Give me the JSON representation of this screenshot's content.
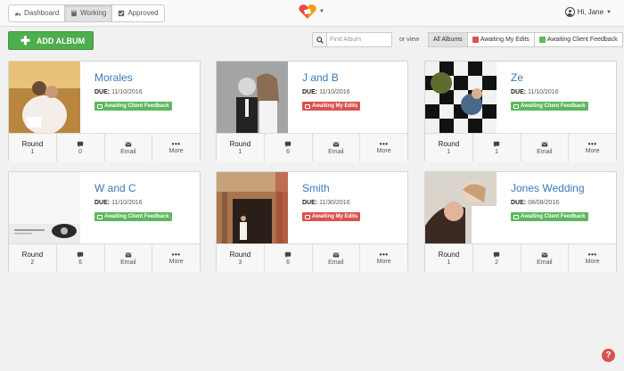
{
  "nav": {
    "dashboard": "Dashboard",
    "working": "Working",
    "approved": "Approved"
  },
  "user": {
    "greeting": "Hi, Jane"
  },
  "toolbar": {
    "add_album": "ADD ALBUM",
    "search_placeholder": "Find Album",
    "or_view": "or view",
    "filters": [
      "All Albums",
      "Awaiting My Edits",
      "Awaiting Client Feedback"
    ]
  },
  "labels": {
    "due": "DUE:",
    "round": "Round",
    "email": "Email",
    "more": "More"
  },
  "colors": {
    "accent_blue": "#3a7ab8",
    "green": "#5cb85c",
    "red": "#d9534f"
  },
  "albums": [
    {
      "title": "Morales",
      "due": "11/10/2016",
      "status": "Awaiting Client Feedback",
      "status_color": "green",
      "round": "1",
      "comments": "0"
    },
    {
      "title": "J and B",
      "due": "11/10/2016",
      "status": "Awaiting My Edits",
      "status_color": "red",
      "round": "1",
      "comments": "6"
    },
    {
      "title": "Ze",
      "due": "11/10/2016",
      "status": "Awaiting Client Feedback",
      "status_color": "green",
      "round": "1",
      "comments": "1"
    },
    {
      "title": "W and C",
      "due": "11/10/2016",
      "status": "Awaiting Client Feedback",
      "status_color": "green",
      "round": "2",
      "comments": "6"
    },
    {
      "title": "Smith",
      "due": "11/30/2016",
      "status": "Awaiting My Edits",
      "status_color": "red",
      "round": "3",
      "comments": "6"
    },
    {
      "title": "Jones Wedding",
      "due": "08/08/2016",
      "status": "Awaiting Client Feedback",
      "status_color": "green",
      "round": "1",
      "comments": "2"
    }
  ],
  "help": "?"
}
